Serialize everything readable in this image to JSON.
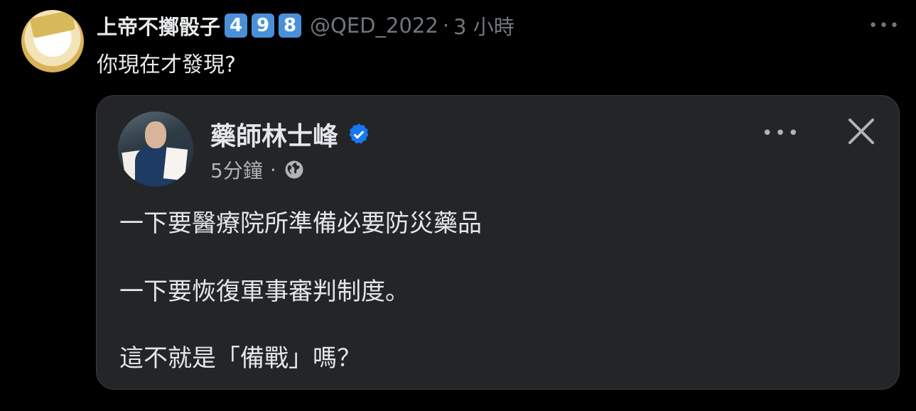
{
  "tweet": {
    "display_name": "上帝不擲骰子",
    "badges": [
      "4",
      "9",
      "8"
    ],
    "handle": "@QED_2022",
    "separator": "·",
    "time": "3 小時",
    "more": "•••",
    "text": "你現在才發現?"
  },
  "embedded_post": {
    "author": "藥師林士峰",
    "time": "5分鐘",
    "separator": "·",
    "more": "•••",
    "lines": [
      "一下要醫療院所準備必要防災藥品",
      "一下要恢復軍事審判制度。",
      "這不就是「備戰」嗎？"
    ]
  },
  "colors": {
    "background": "#000000",
    "card": "#242526",
    "badge": "#4a90d9",
    "verified": "#1877f2",
    "muted": "#71767b"
  }
}
